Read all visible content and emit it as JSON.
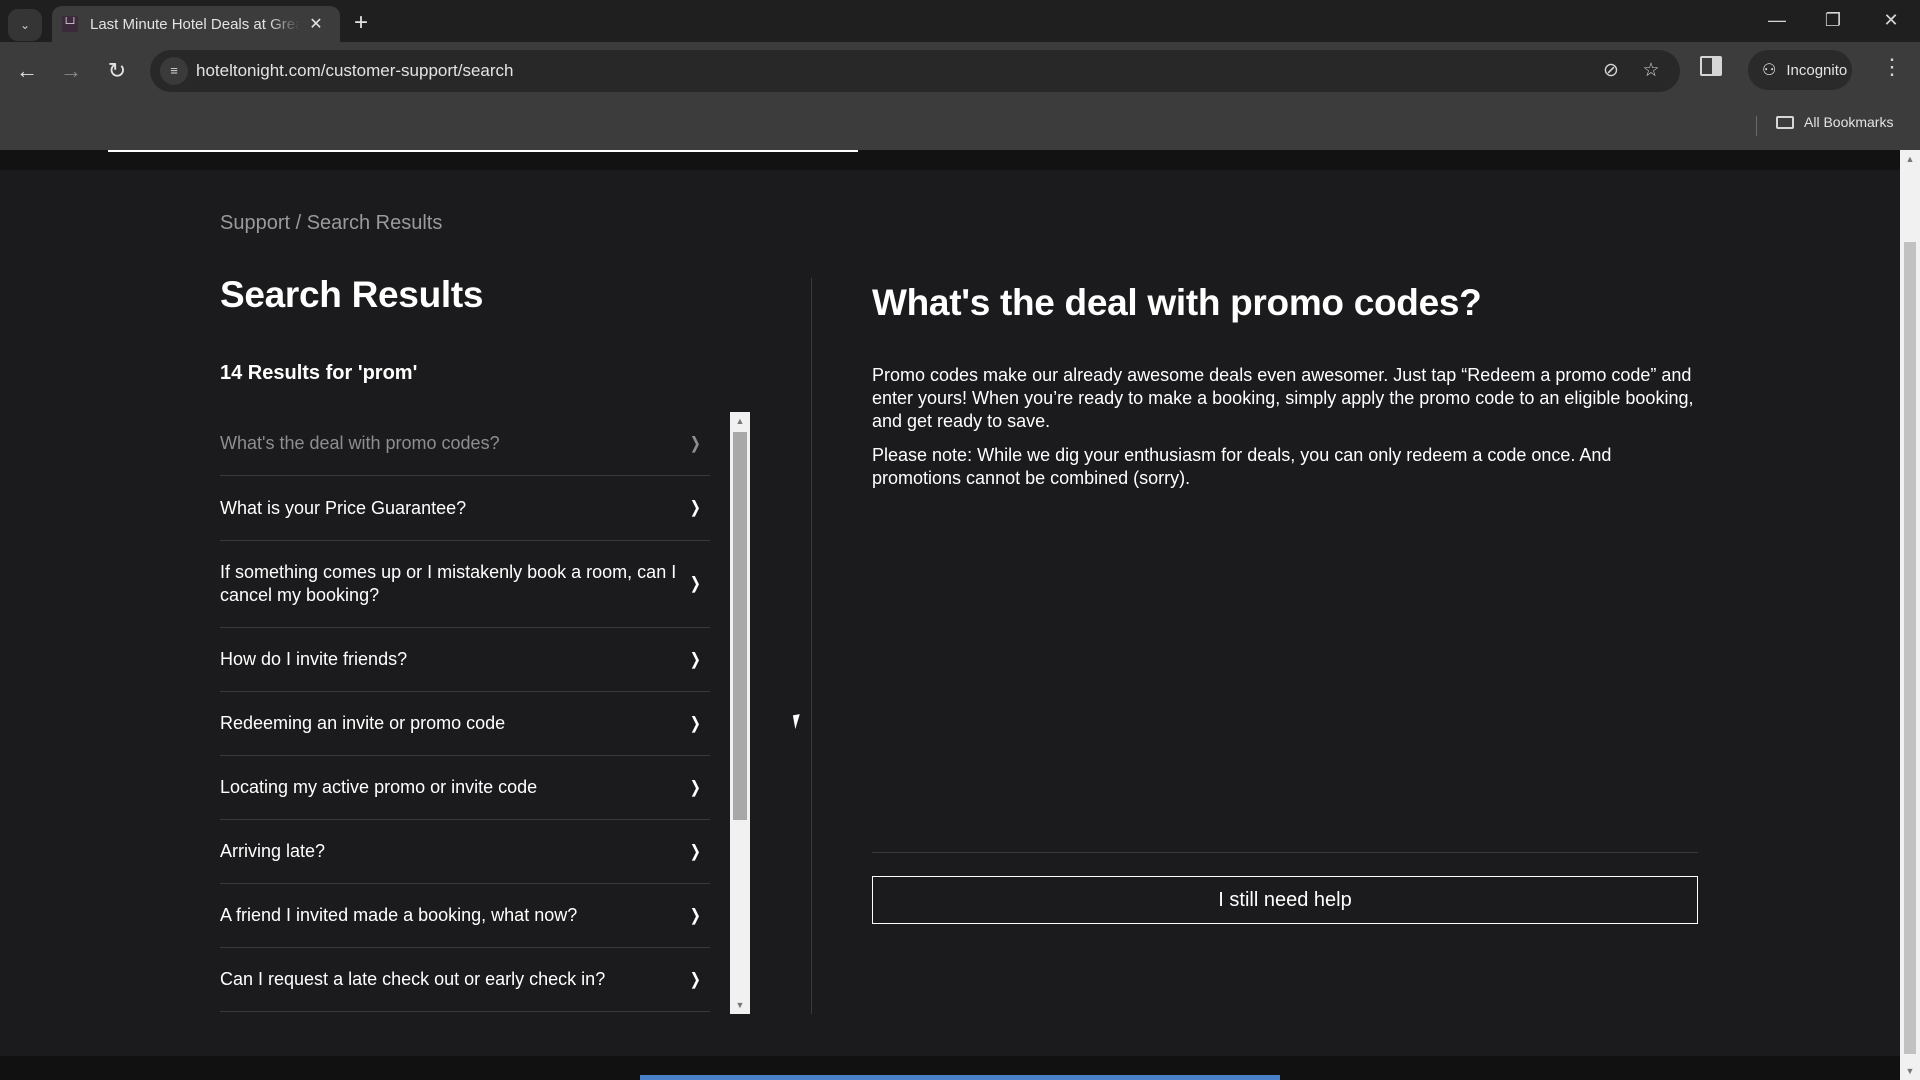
{
  "browser": {
    "tab_title": "Last Minute Hotel Deals at Great Prices",
    "url": "hoteltonight.com/customer-support/search",
    "incognito_label": "Incognito",
    "all_bookmarks_label": "All Bookmarks",
    "icons": {
      "tab_search": "chevron-down-icon",
      "favicon": "bed-icon",
      "close_tab": "close-icon",
      "new_tab": "plus-icon",
      "back": "arrow-left-icon",
      "forward": "arrow-right-icon",
      "reload": "reload-icon",
      "site_info": "tune-icon",
      "tracking": "eye-off-icon",
      "bookmark": "star-icon",
      "side_panel": "side-panel-icon",
      "incognito": "incognito-icon",
      "menu": "kebab-menu-icon",
      "folder": "folder-icon",
      "minimize": "minimize-icon",
      "maximize": "restore-icon",
      "close_window": "close-icon"
    }
  },
  "page": {
    "breadcrumb": "Support / Search Results",
    "title": "Search Results",
    "result_count": "14 Results for 'prom'",
    "results": [
      {
        "label": "What's the deal with promo codes?",
        "active": true
      },
      {
        "label": "What is your Price Guarantee?",
        "active": false
      },
      {
        "label": "If something comes up or I mistakenly book a room, can I cancel my booking?",
        "active": false
      },
      {
        "label": "How do I invite friends?",
        "active": false
      },
      {
        "label": "Redeeming an invite or promo code",
        "active": false
      },
      {
        "label": "Locating my active promo or invite code",
        "active": false
      },
      {
        "label": "Arriving late?",
        "active": false
      },
      {
        "label": "A friend I invited made a booking, what now?",
        "active": false
      },
      {
        "label": "Can I request a late check out or early check in?",
        "active": false
      }
    ],
    "article": {
      "title": "What's the deal with promo codes?",
      "paragraphs": [
        "Promo codes make our already awesome deals even awesomer. Just tap “Redeem a promo code” and enter yours! When you’re ready to make a booking, simply apply the promo code to an eligible booking, and get ready to save.",
        "Please note: While we dig your enthusiasm for deals, you can only redeem a code once. And promotions cannot be combined (sorry)."
      ],
      "help_button": "I still need help"
    }
  },
  "colors": {
    "background": "#1b1b1d",
    "text": "#ffffff",
    "muted_text": "#9a9a9a",
    "active_item": "#8e8e8e",
    "accent_blue": "#4a80c8"
  }
}
